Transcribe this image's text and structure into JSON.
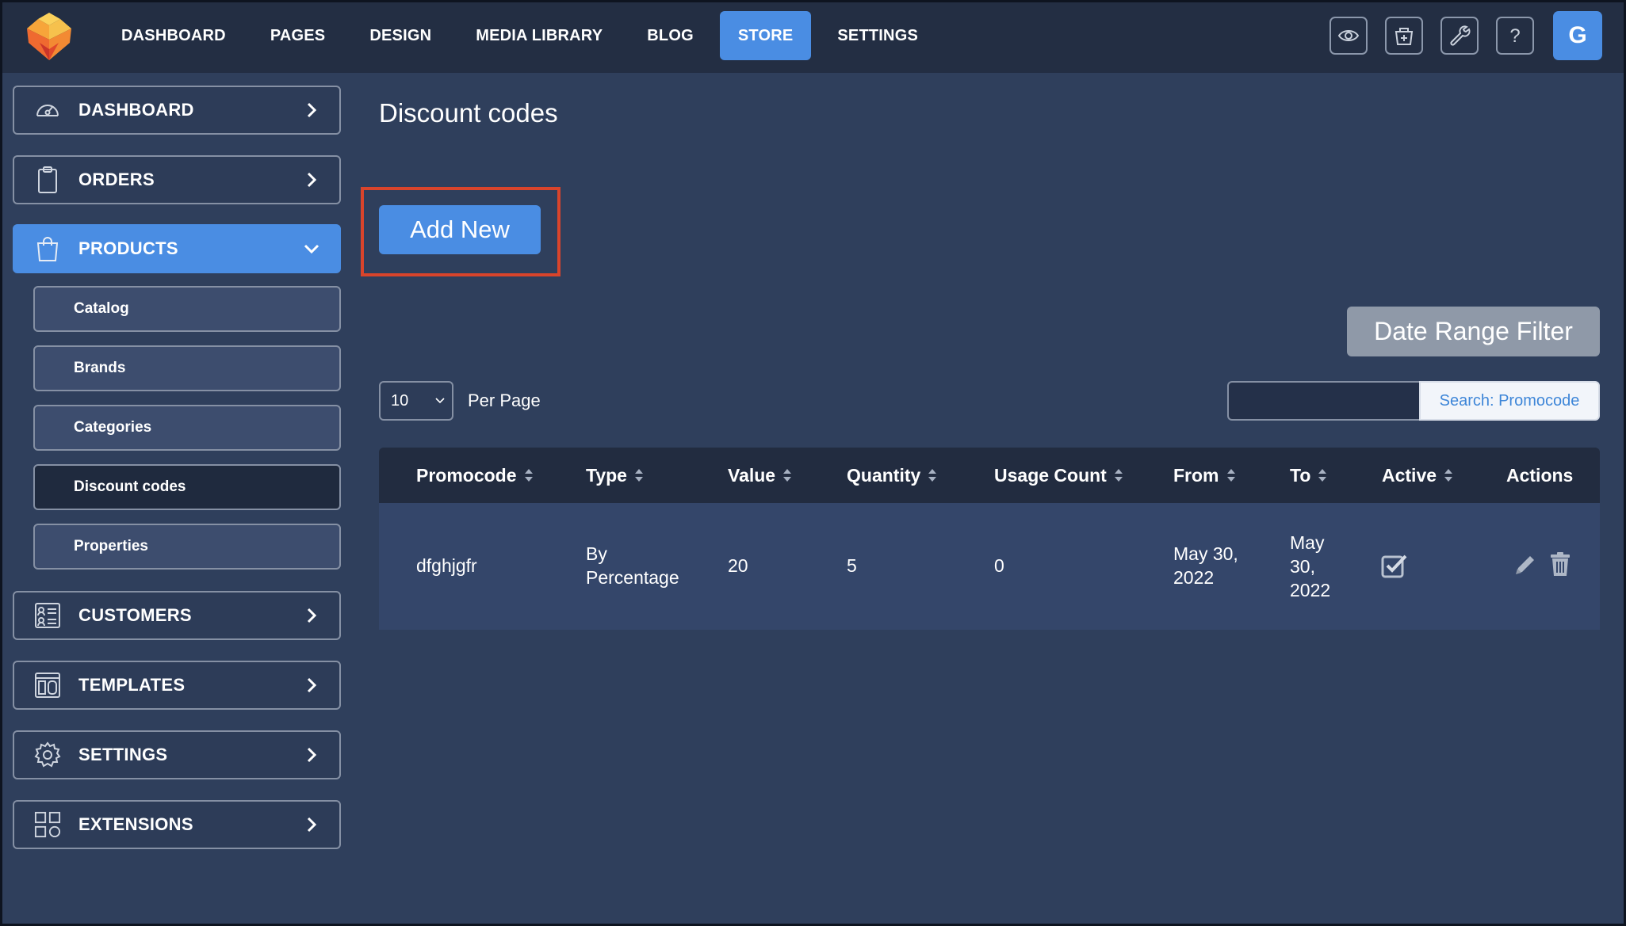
{
  "nav": {
    "items": [
      "DASHBOARD",
      "PAGES",
      "DESIGN",
      "MEDIA LIBRARY",
      "BLOG",
      "STORE",
      "SETTINGS"
    ],
    "active": "STORE",
    "icons": [
      "eye-icon",
      "store-add-icon",
      "wrench-icon",
      "help-icon"
    ],
    "avatar_letter": "G"
  },
  "sidebar": {
    "items": [
      {
        "label": "DASHBOARD",
        "icon": "gauge-icon"
      },
      {
        "label": "ORDERS",
        "icon": "clipboard-icon"
      },
      {
        "label": "PRODUCTS",
        "icon": "shopping-bag-icon"
      },
      {
        "label": "CUSTOMERS",
        "icon": "contact-card-icon"
      },
      {
        "label": "TEMPLATES",
        "icon": "template-icon"
      },
      {
        "label": "SETTINGS",
        "icon": "gear-icon"
      },
      {
        "label": "EXTENSIONS",
        "icon": "extensions-grid-icon"
      }
    ],
    "products_sub": [
      "Catalog",
      "Brands",
      "Categories",
      "Discount codes",
      "Properties"
    ],
    "current_sub": "Discount codes"
  },
  "main": {
    "title": "Discount codes",
    "add_button": "Add New",
    "date_filter_button": "Date Range Filter",
    "per_page_value": "10",
    "per_page_label": "Per Page",
    "search_button": "Search: Promocode",
    "search_value": ""
  },
  "table": {
    "headers": [
      "Promocode",
      "Type",
      "Value",
      "Quantity",
      "Usage Count",
      "From",
      "To",
      "Active",
      "Actions"
    ],
    "rows": [
      {
        "promocode": "dfghjgfr",
        "type_line1": "By",
        "type_line2": "Percentage",
        "value": "20",
        "quantity": "5",
        "usage_count": "0",
        "from_line1": "May 30,",
        "from_line2": "2022",
        "to_line1": "May",
        "to_line2": "30,",
        "to_line3": "2022",
        "active": true
      }
    ]
  },
  "colors": {
    "accent": "#4a8de3",
    "background": "#2f3f5c",
    "topbar": "#232e43",
    "highlight": "#d9442b"
  }
}
